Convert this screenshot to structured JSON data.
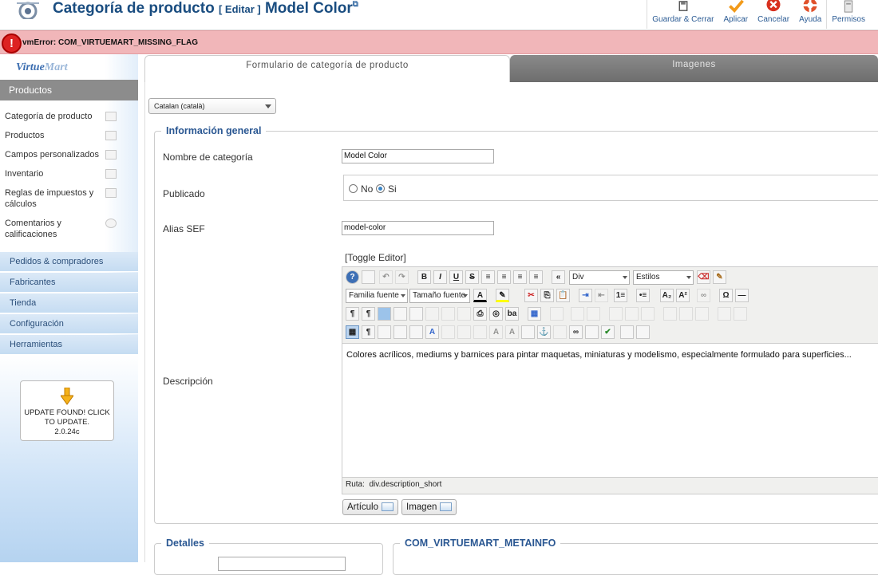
{
  "header": {
    "title": "Categoría de producto",
    "edit_tag": "[ Editar ]",
    "item_name": "Model Color",
    "external_link_glyph": "⧉"
  },
  "toolbar": [
    {
      "icon": "save-close-icon",
      "label": "Guardar & Cerrar"
    },
    {
      "icon": "apply-check-icon",
      "label": "Aplicar"
    },
    {
      "icon": "cancel-icon",
      "label": "Cancelar"
    },
    {
      "icon": "help-icon",
      "label": "Ayuda"
    },
    {
      "icon": "permissions-icon",
      "label": "Permisos"
    }
  ],
  "error": {
    "icon": "!",
    "message": "vmError: COM_VIRTUEMART_MISSING_FLAG"
  },
  "sidebar": {
    "logo_text_a": "Virtue",
    "logo_text_b": "Mart",
    "section_products": "Productos",
    "items": [
      {
        "label": "Categoría de producto"
      },
      {
        "label": "Productos"
      },
      {
        "label": "Campos personalizados"
      },
      {
        "label": "Inventario"
      },
      {
        "label": "Reglas de impuestos y cálculos"
      },
      {
        "label": "Comentarios y calificaciones"
      }
    ],
    "sections": [
      {
        "label": "Pedidos & compradores"
      },
      {
        "label": "Fabricantes"
      },
      {
        "label": "Tienda"
      },
      {
        "label": "Configuración"
      },
      {
        "label": "Herramientas"
      }
    ],
    "update": {
      "line1": "UPDATE FOUND! CLICK",
      "line2": "TO UPDATE.",
      "version": "2.0.24c"
    }
  },
  "tabs": [
    {
      "label": "Formulario de categoría de producto",
      "active": true
    },
    {
      "label": "Imagenes",
      "active": false
    }
  ],
  "language_select": {
    "value": "Catalan (català)"
  },
  "general": {
    "legend": "Información general",
    "name_label": "Nombre de categoría",
    "name_value": "Model Color",
    "published_label": "Publicado",
    "published_options": [
      {
        "label": "No",
        "checked": false
      },
      {
        "label": "Si",
        "checked": true
      }
    ],
    "alias_label": "Alias SEF",
    "alias_value": "model-color",
    "toggle_editor": "[Toggle Editor]",
    "description_label": "Descripción",
    "description_value": "Colores acrílicos, mediums y barnices para pintar maquetas, miniaturas y modelismo, especialmente formulado para superficies...",
    "path_label": "Ruta:",
    "path_value": "div.description_short",
    "article_button": "Artículo",
    "image_button": "Imagen"
  },
  "editor_toolbar": {
    "format_select": "Div",
    "styles_select": "Estilos",
    "font_family_select": "Familia fuente",
    "font_size_select": "Tamaño fuente",
    "bold": "B",
    "italic": "I",
    "underline": "U",
    "strike": "S",
    "omega": "Ω",
    "subscript": "A₂",
    "superscript": "A²",
    "pilcrow": "¶"
  },
  "details": {
    "legend": "Detalles"
  },
  "meta": {
    "legend": "COM_VIRTUEMART_METAINFO"
  },
  "colors": {
    "accent": "#1a4d80",
    "error_bg": "#f1b6b9",
    "sidebar_head": "#8c8c8c",
    "tab_inactive": "#7a7a7a"
  }
}
